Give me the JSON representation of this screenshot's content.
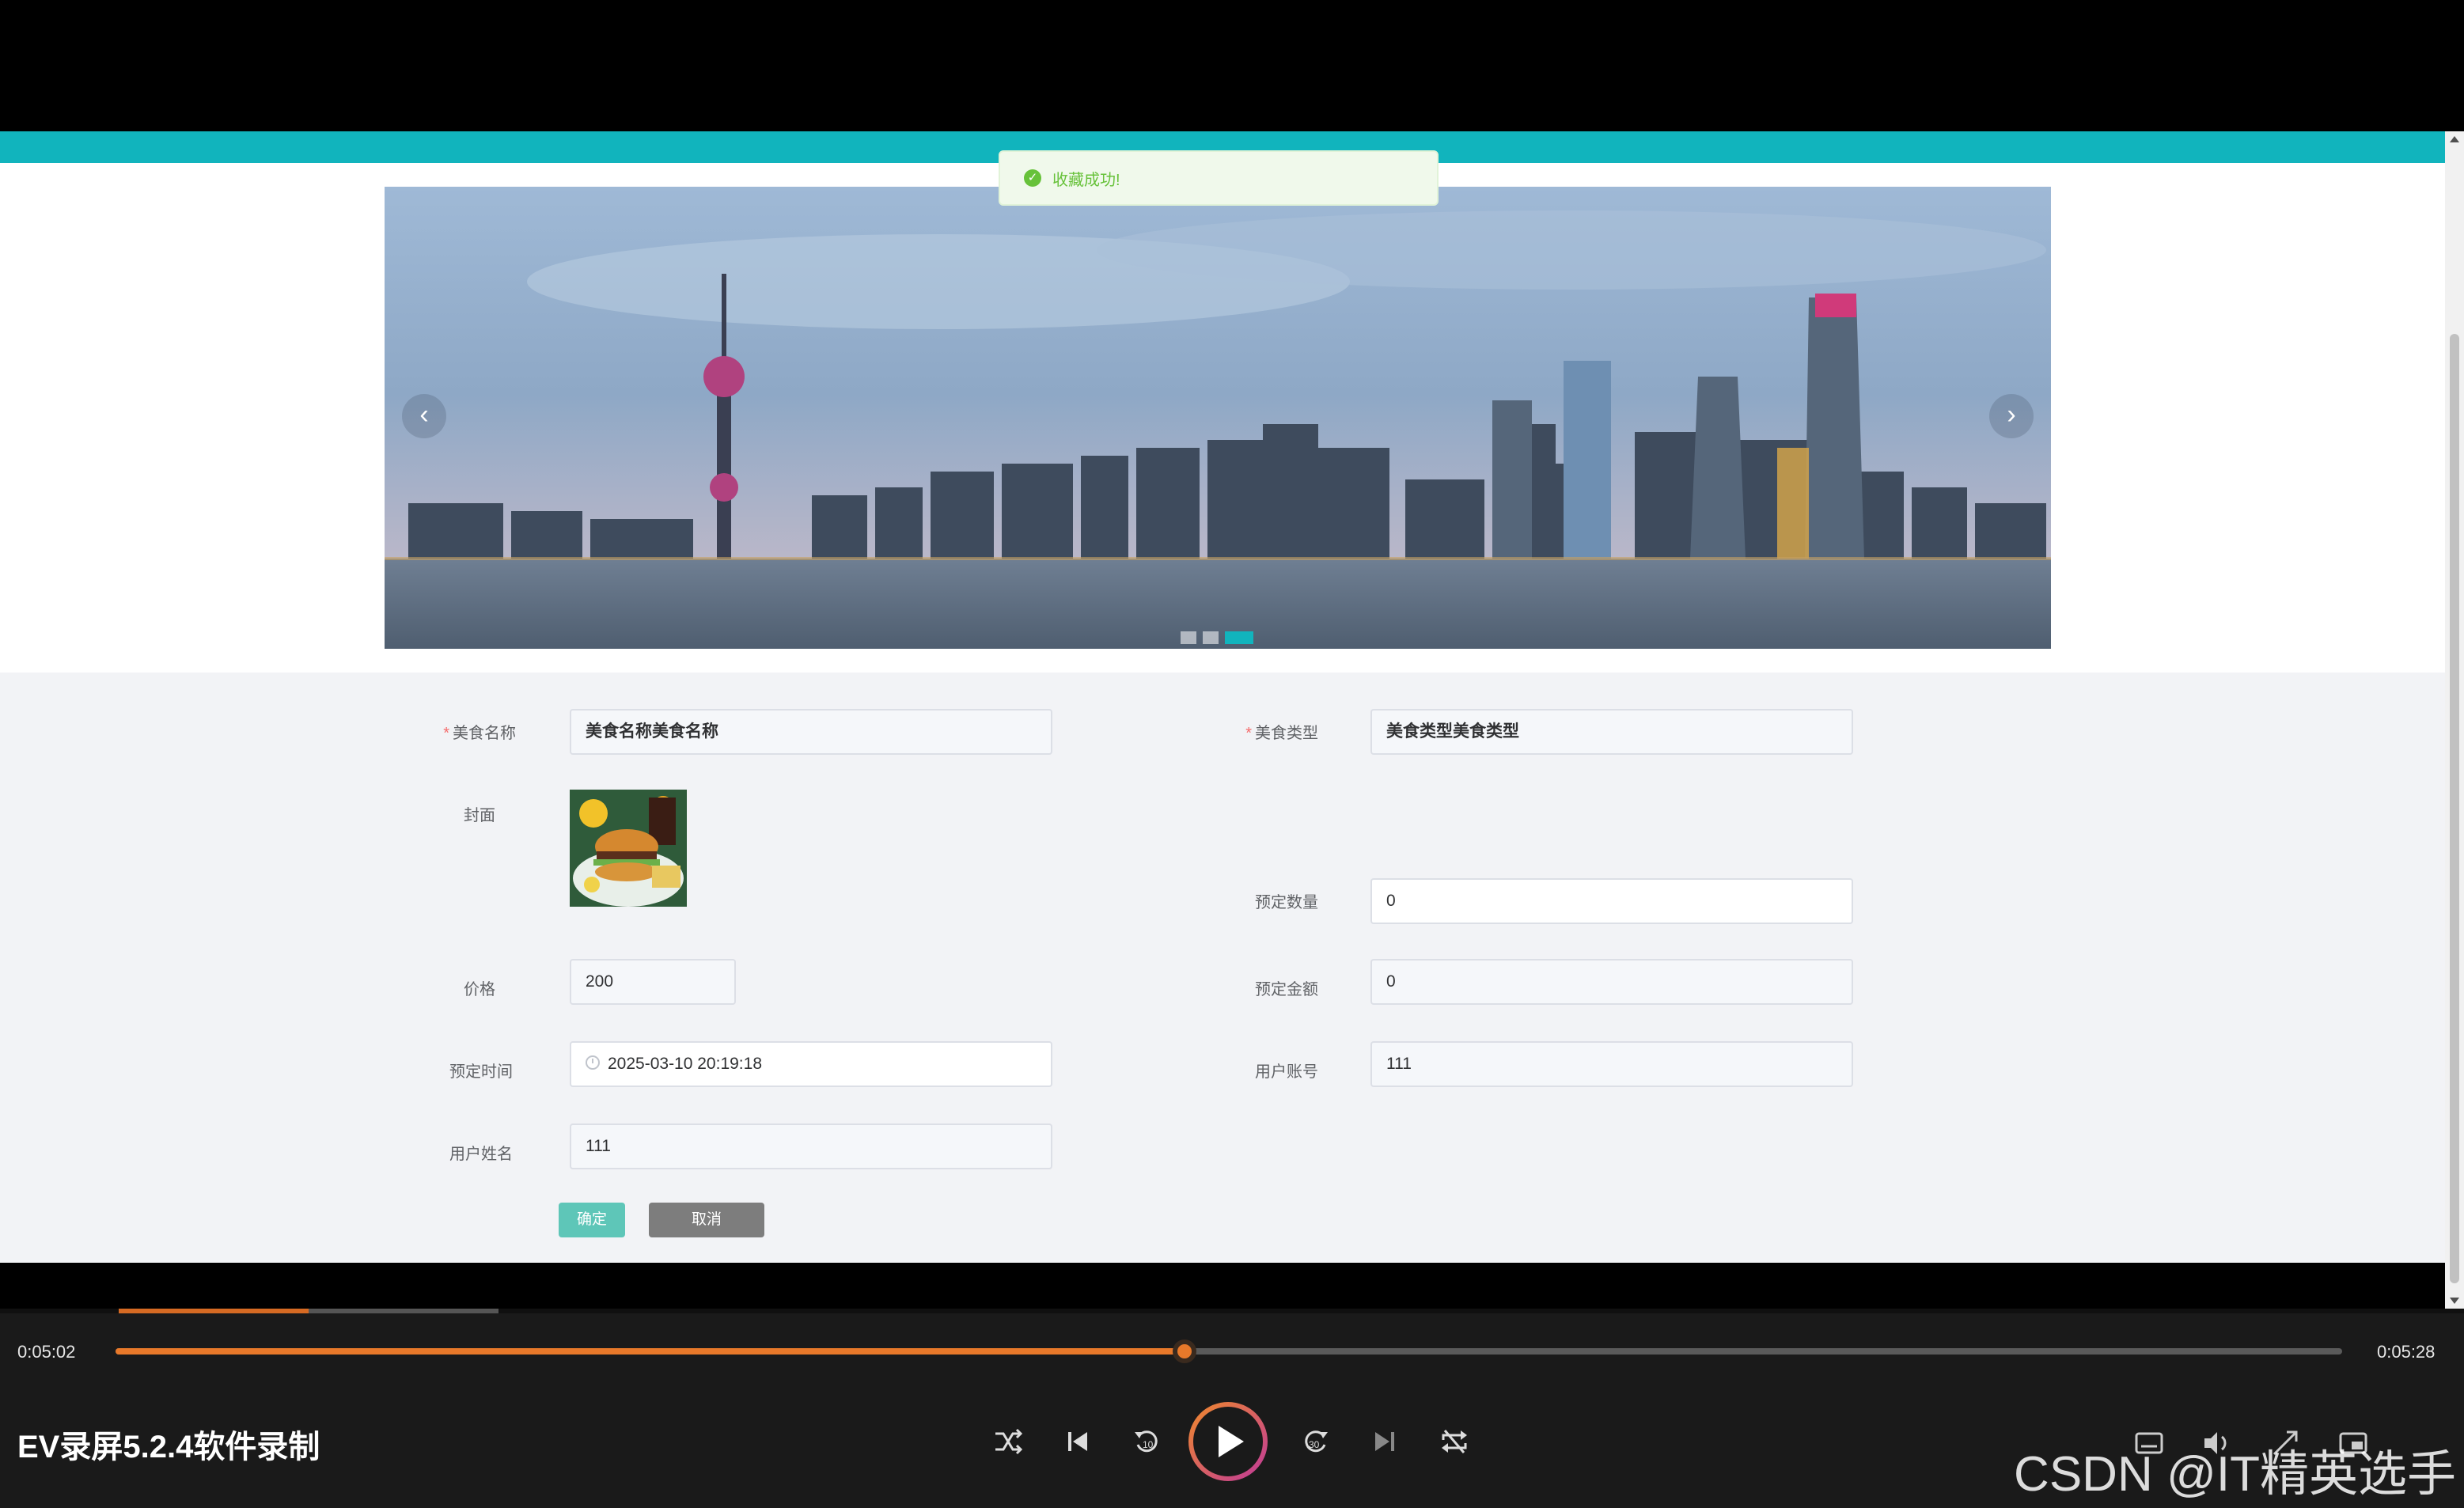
{
  "toast": {
    "icon": "check-circle-icon",
    "message": "收藏成功!"
  },
  "carousel": {
    "prev_icon": "‹",
    "next_icon": "›",
    "slide_count": 3,
    "active_index": 2
  },
  "form": {
    "food_name": {
      "label": "美食名称",
      "value": "美食名称美食名称",
      "required": true
    },
    "food_type": {
      "label": "美食类型",
      "value": "美食类型美食类型",
      "required": true
    },
    "cover": {
      "label": "封面"
    },
    "reserve_qty": {
      "label": "预定数量",
      "value": "0"
    },
    "price": {
      "label": "价格",
      "value": "200"
    },
    "reserve_amount": {
      "label": "预定金额",
      "value": "0"
    },
    "reserve_time": {
      "label": "预定时间",
      "value": "2025-03-10 20:19:18"
    },
    "user_account": {
      "label": "用户账号",
      "value": "111"
    },
    "user_name": {
      "label": "用户姓名",
      "value": "111"
    },
    "confirm_label": "确定",
    "cancel_label": "取消"
  },
  "player": {
    "current_time": "0:05:02",
    "total_time": "0:05:28",
    "progress_fraction": 0.48,
    "title": "EV录屏5.2.4软件录制",
    "controls": [
      "shuffle-icon",
      "previous-icon",
      "rewind-10-icon",
      "play-icon",
      "forward-30-icon",
      "next-icon",
      "repeat-icon"
    ]
  },
  "watermark": "CSDN @IT精英选手",
  "colors": {
    "accent": "#11b4bd",
    "progress": "#e8792a",
    "success": "#67c23a"
  }
}
